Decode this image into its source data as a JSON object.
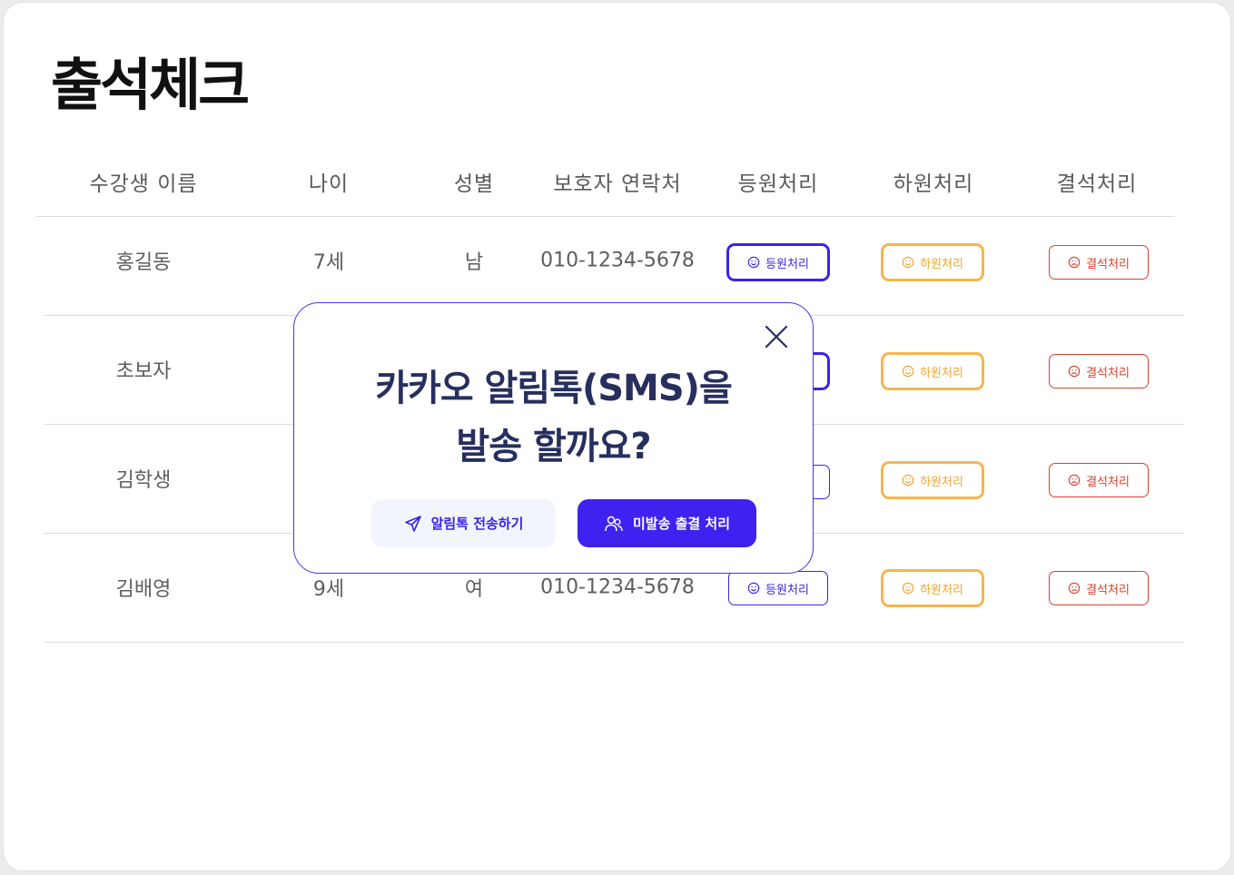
{
  "page": {
    "title": "출석체크"
  },
  "table": {
    "headers": [
      "수강생 이름",
      "나이",
      "성별",
      "보호자 연락처",
      "등원처리",
      "하원처리",
      "결석처리"
    ],
    "rows": [
      {
        "name": "홍길동",
        "age": "7세",
        "gender": "남",
        "phone": "010-1234-5678"
      },
      {
        "name": "초보자",
        "age": "",
        "gender": "",
        "phone": ""
      },
      {
        "name": "김학생",
        "age": "",
        "gender": "",
        "phone": ""
      },
      {
        "name": "김배영",
        "age": "9세",
        "gender": "여",
        "phone": "010-1234-5678"
      }
    ],
    "buttons": {
      "attend_label": "등원처리",
      "leave_label": "하원처리",
      "absent_label": "결석처리"
    }
  },
  "modal": {
    "title_line1": "카카오 알림톡(SMS)을",
    "title_line2": "발송 할까요?",
    "send_label": "알림톡 전송하기",
    "nosend_label": "미발송 출결 처리"
  },
  "colors": {
    "primary": "#3f22f0",
    "attend": "#3a24e6",
    "leave": "#f7b54c",
    "absent": "#d9402e",
    "title_navy": "#262f5e"
  },
  "icons": {
    "attend": "smile-icon",
    "leave": "smile-icon",
    "absent": "sad-face-icon",
    "send": "paper-plane-icon",
    "nosend": "users-icon",
    "close": "close-icon"
  }
}
